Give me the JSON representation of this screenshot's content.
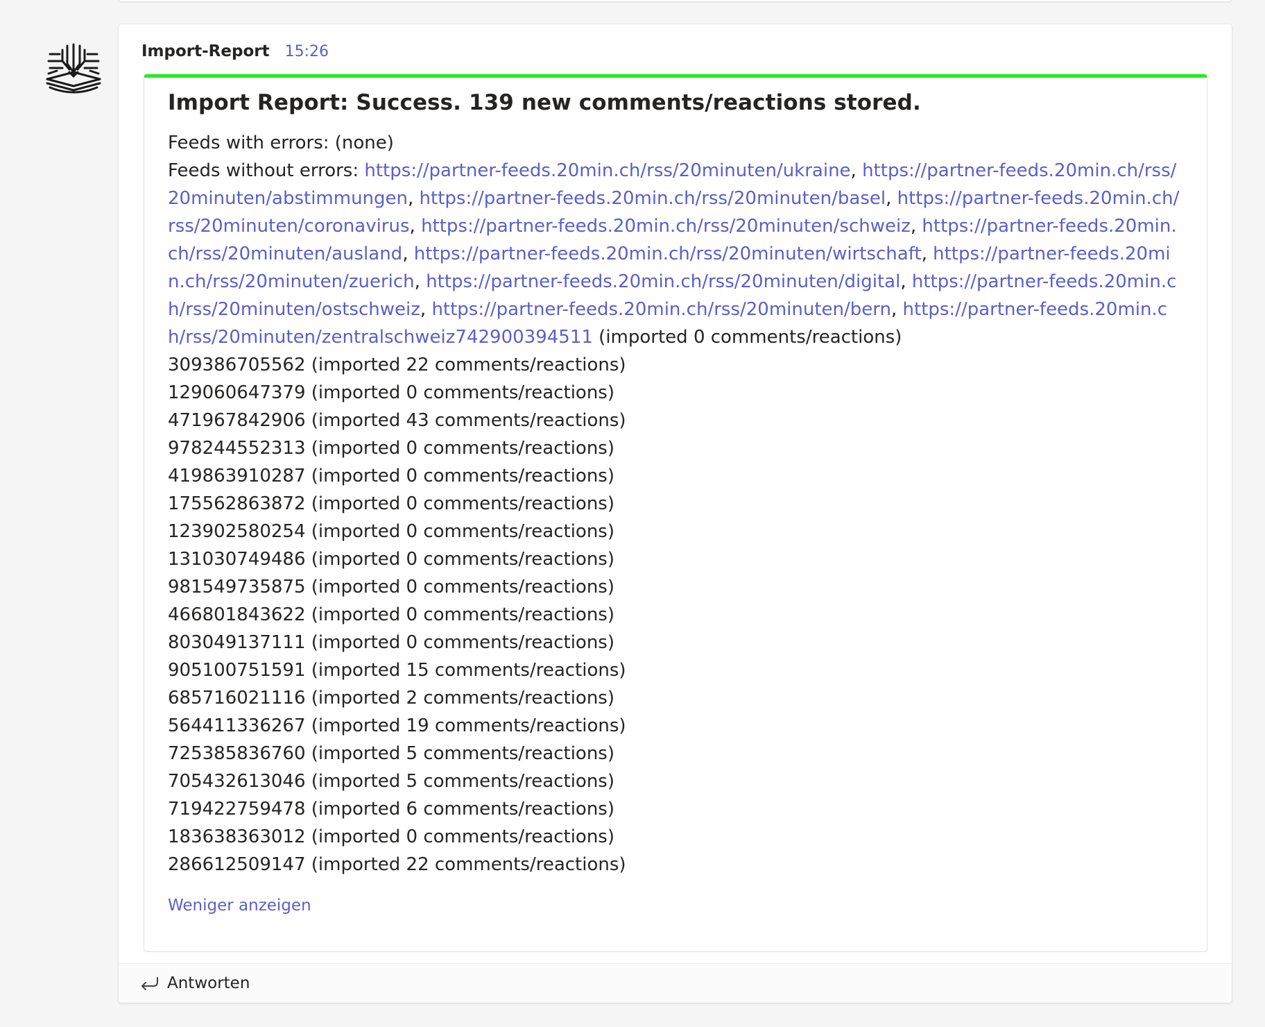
{
  "message": {
    "sender": "Import-Report",
    "time": "15:26",
    "avatar_icon": "book-tree-icon",
    "accent_color": "#22ee22",
    "link_color": "#5b5fc7"
  },
  "report": {
    "title": "Import Report: Success. 139 new comments/reactions stored.",
    "errors_line": "Feeds with errors: (none)",
    "feeds_label": "Feeds without errors: ",
    "feeds": [
      "https://partner-feeds.20min.ch/rss/20minuten/ukraine",
      "https://partner-feeds.20min.ch/rss/20minuten/abstimmungen",
      "https://partner-feeds.20min.ch/rss/20minuten/basel",
      "https://partner-feeds.20min.ch/rss/20minuten/coronavirus",
      "https://partner-feeds.20min.ch/rss/20minuten/schweiz",
      "https://partner-feeds.20min.ch/rss/20minuten/ausland",
      "https://partner-feeds.20min.ch/rss/20minuten/wirtschaft",
      "https://partner-feeds.20min.ch/rss/20minuten/zuerich",
      "https://partner-feeds.20min.ch/rss/20minuten/digital",
      "https://partner-feeds.20min.ch/rss/20minuten/ostschweiz",
      "https://partner-feeds.20min.ch/rss/20minuten/bern",
      "https://partner-feeds.20min.ch/rss/20minuten/zentralschweiz742900394511"
    ],
    "feeds_suffix": " (imported 0 comments/reactions)",
    "entries": [
      "309386705562 (imported 22 comments/reactions)",
      "129060647379 (imported 0 comments/reactions)",
      "471967842906 (imported 43 comments/reactions)",
      "978244552313 (imported 0 comments/reactions)",
      "419863910287 (imported 0 comments/reactions)",
      "175562863872 (imported 0 comments/reactions)",
      "123902580254 (imported 0 comments/reactions)",
      "131030749486 (imported 0 comments/reactions)",
      "981549735875 (imported 0 comments/reactions)",
      "466801843622 (imported 0 comments/reactions)",
      "803049137111 (imported 0 comments/reactions)",
      "905100751591 (imported 15 comments/reactions)",
      "685716021116 (imported 2 comments/reactions)",
      "564411336267 (imported 19 comments/reactions)",
      "725385836760 (imported 5 comments/reactions)",
      "705432613046 (imported 5 comments/reactions)",
      "719422759478 (imported 6 comments/reactions)",
      "183638363012 (imported 0 comments/reactions)",
      "286612509147 (imported 22 comments/reactions)"
    ],
    "show_less": "Weniger anzeigen"
  },
  "reply": {
    "label": "Antworten",
    "icon": "reply-arrow-icon"
  }
}
